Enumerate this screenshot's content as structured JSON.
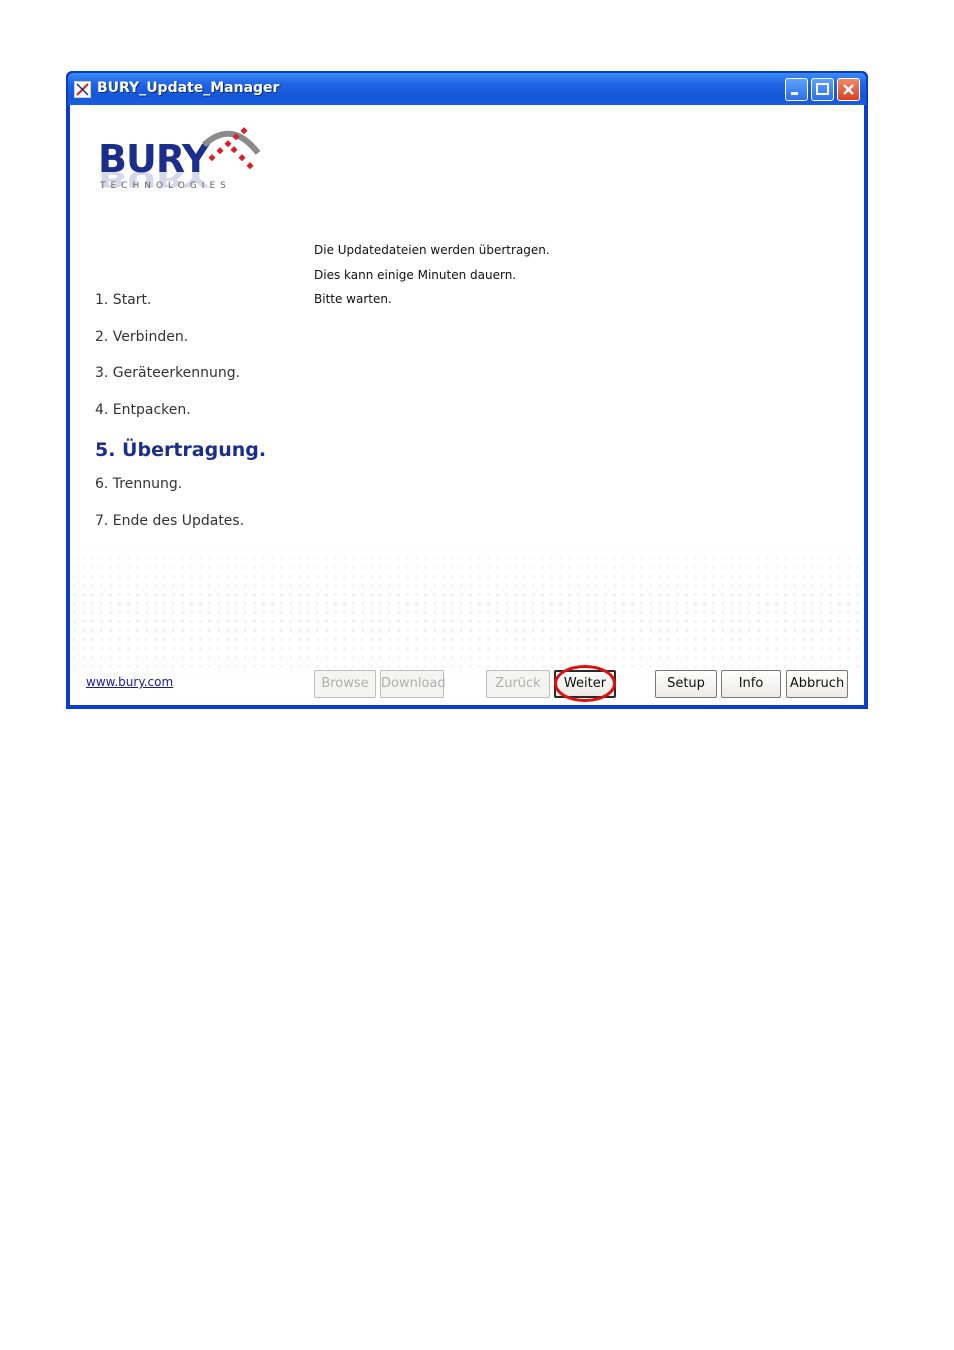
{
  "window": {
    "title": "BURY_Update_Manager"
  },
  "logo": {
    "name": "BURY",
    "tagline": "TECHNOLOGIES"
  },
  "steps": [
    {
      "label": "1. Start."
    },
    {
      "label": "2. Verbinden."
    },
    {
      "label": "3. Geräteerkennung."
    },
    {
      "label": "4. Entpacken."
    },
    {
      "label": "5. Übertragung.",
      "active": true
    },
    {
      "label": "6. Trennung."
    },
    {
      "label": "7. Ende des Updates."
    }
  ],
  "message": {
    "line1": "Die Updatedateien werden übertragen.",
    "line2": "Dies kann einige Minuten dauern.",
    "line3": "Bitte warten."
  },
  "footer": {
    "link": "www.bury.com",
    "buttons": {
      "browse": "Browse",
      "download": "Download",
      "zuruck": "Zurück",
      "weiter": "Weiter",
      "setup": "Setup",
      "info": "Info",
      "abbruch": "Abbruch"
    }
  },
  "colors": {
    "titlebar": "#1f63e6",
    "brand": "#1b2f8a",
    "highlight": "#e01010"
  }
}
